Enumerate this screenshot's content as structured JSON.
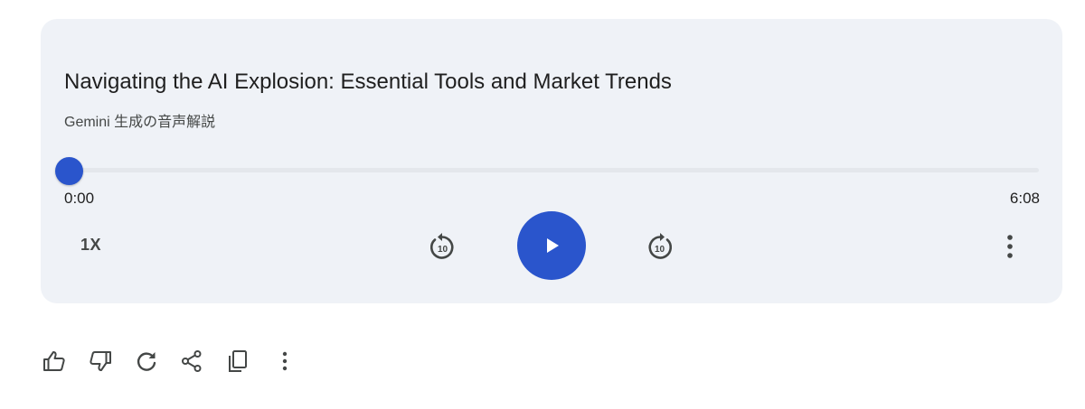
{
  "player": {
    "title": "Navigating the AI Explosion: Essential Tools and Market Trends",
    "subtitle": "Gemini 生成の音声解説",
    "current_time": "0:00",
    "total_time": "6:08",
    "progress": 0,
    "speed_label": "1X",
    "skip_seconds": "10"
  },
  "icons": {
    "rewind": "replay-10-icon",
    "play": "play-icon",
    "forward": "forward-10-icon",
    "more": "more-vert-icon",
    "actions": [
      "thumb-up-icon",
      "thumb-down-icon",
      "refresh-icon",
      "share-icon",
      "copy-icon",
      "more-vert-icon"
    ]
  },
  "colors": {
    "accent": "#2a55cc",
    "card_background": "#eff2f7",
    "icon": "#444746"
  }
}
